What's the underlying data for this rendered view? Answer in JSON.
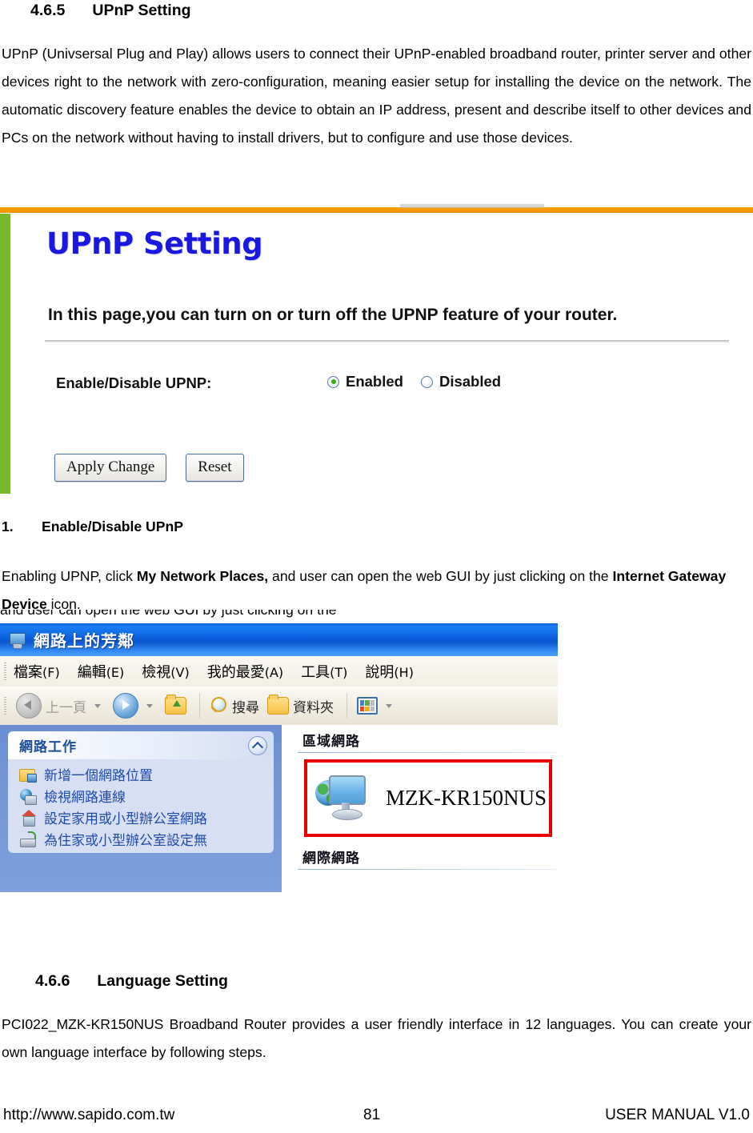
{
  "sections": {
    "upnp": {
      "number": "4.6.5",
      "title": "UPnP Setting",
      "paragraph": "UPnP (Univsersal Plug and Play) allows users to connect their UPnP-enabled broadband router, printer server and other devices right to the network with zero-configuration, meaning easier setup for installing the device on the network. The automatic discovery feature enables the device to obtain an IP address, present and describe itself to other devices and PCs on the network without having to install drivers, but to configure and use those devices."
    },
    "item1": {
      "number": "1.",
      "title": "Enable/Disable UPnP",
      "text_before": "Enabling UPNP, click ",
      "bold1": "My Network Places,",
      "text_mid": " and user can open the web GUI by just clicking on the ",
      "bold2": "Internet Gateway Device",
      "text_after": " icon."
    },
    "language": {
      "number": "4.6.6",
      "title": "Language Setting",
      "paragraph": "PCI022_MZK-KR150NUS Broadband Router provides a user friendly interface in 12 languages. You can create your own language interface by following steps."
    }
  },
  "router_ui": {
    "title": "UPnP Setting",
    "description": "In this page,you can turn on or turn off the UPNP feature of your router.",
    "row_label": "Enable/Disable UPNP:",
    "radios": [
      {
        "label": "Enabled",
        "checked": true
      },
      {
        "label": "Disabled",
        "checked": false
      }
    ],
    "buttons": {
      "apply": "Apply Change",
      "reset": "Reset"
    },
    "colors": {
      "title": "#1a17e0",
      "top_border": "#f39800",
      "left_bar": "#76b82a",
      "radio_dot": "#33b008"
    }
  },
  "explorer": {
    "title": "網路上的芳鄰",
    "menu": [
      {
        "label": "檔案",
        "mnemonic": "(F)"
      },
      {
        "label": "編輯",
        "mnemonic": "(E)"
      },
      {
        "label": "檢視",
        "mnemonic": "(V)"
      },
      {
        "label": "我的最愛",
        "mnemonic": "(A)"
      },
      {
        "label": "工具",
        "mnemonic": "(T)"
      },
      {
        "label": "說明",
        "mnemonic": "(H)"
      }
    ],
    "toolbar": {
      "back": "上一頁",
      "search": "搜尋",
      "folders": "資料夾"
    },
    "sidebar": {
      "header": "網路工作",
      "items": [
        "新增一個網路位置",
        "檢視網路連線",
        "設定家用或小型辦公室網路",
        "為住家或小型辦公室設定無"
      ]
    },
    "main": {
      "group_local": "區域網路",
      "group_internet": "網際網路",
      "device_name": "MZK-KR150NUS",
      "highlight_color": "#e60000"
    }
  },
  "footer": {
    "url": "http://www.sapido.com.tw",
    "page": "81",
    "manual": "USER MANUAL V1.0"
  }
}
